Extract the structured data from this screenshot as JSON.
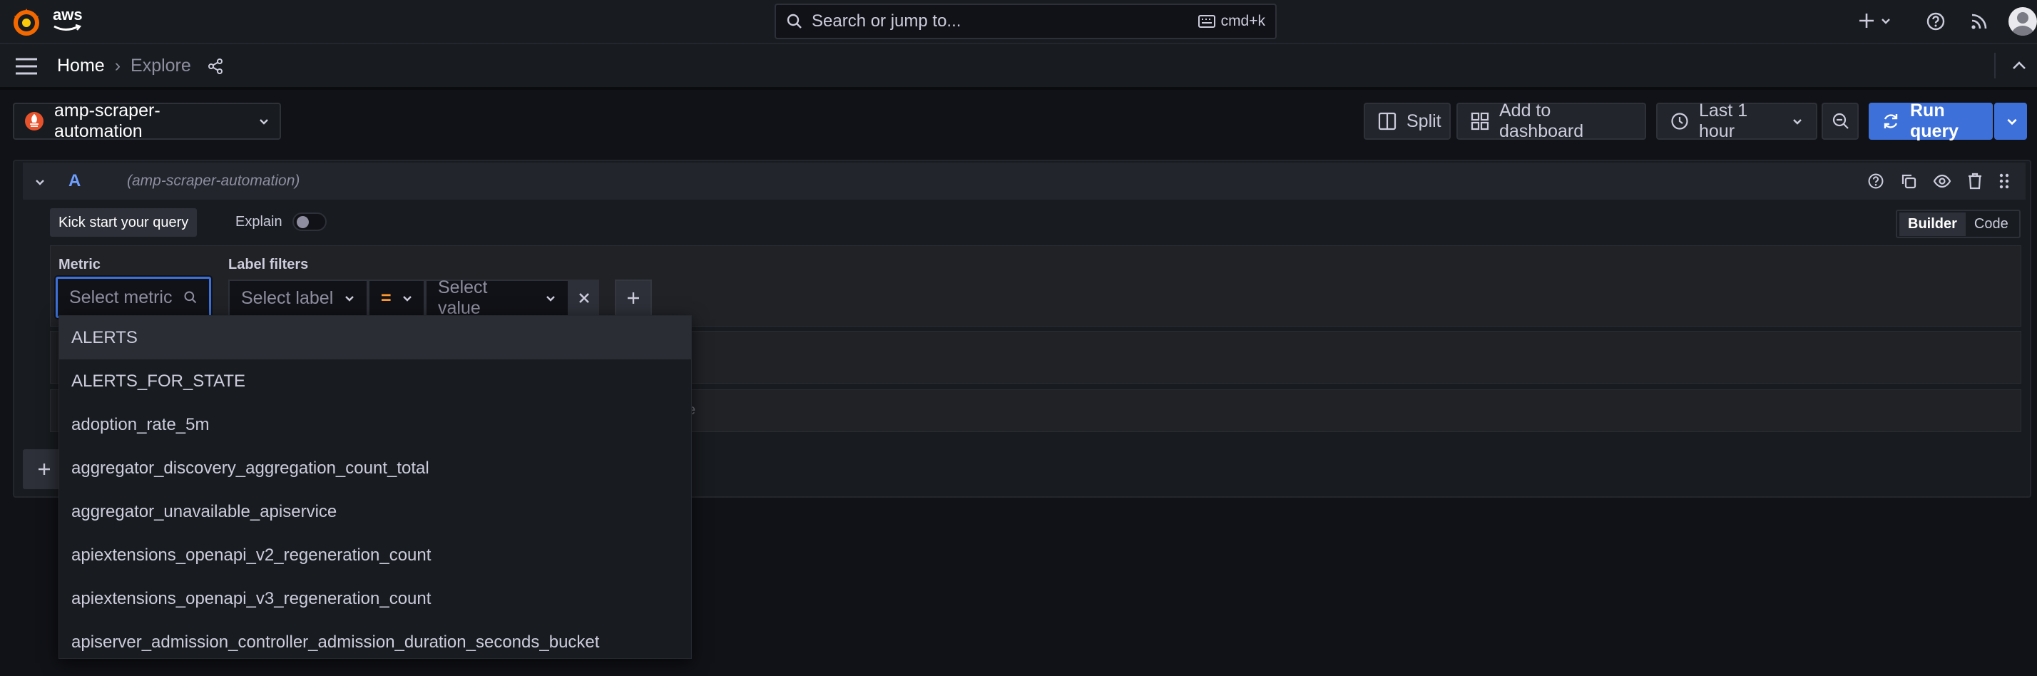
{
  "topbar": {
    "logo_text": "aws",
    "search_placeholder": "Search or jump to...",
    "search_shortcut": "cmd+k"
  },
  "breadcrumb": {
    "home": "Home",
    "separator": "›",
    "current": "Explore"
  },
  "toolbar": {
    "datasource": "amp-scraper-automation",
    "split": "Split",
    "add_to_dashboard": "Add to dashboard",
    "time_range": "Last 1 hour",
    "run_query": "Run query"
  },
  "query": {
    "ref_id": "A",
    "datasource_hint": "(amp-scraper-automation)",
    "kick_start": "Kick start your query",
    "explain": "Explain",
    "mode_builder": "Builder",
    "mode_code": "Code",
    "metric_label": "Metric",
    "metric_placeholder": "Select metric",
    "label_filters": "Label filters",
    "select_label": "Select label",
    "operator": "=",
    "select_value": "Select value",
    "row3_fragment": "e"
  },
  "metric_options": [
    "ALERTS",
    "ALERTS_FOR_STATE",
    "adoption_rate_5m",
    "aggregator_discovery_aggregation_count_total",
    "aggregator_unavailable_apiservice",
    "apiextensions_openapi_v2_regeneration_count",
    "apiextensions_openapi_v3_regeneration_count",
    "apiserver_admission_controller_admission_duration_seconds_bucket"
  ],
  "colors": {
    "background": "#111217",
    "panel": "#181b1f",
    "primary": "#3d71d9",
    "operator": "#ff9830",
    "focus": "#3d71d9"
  }
}
